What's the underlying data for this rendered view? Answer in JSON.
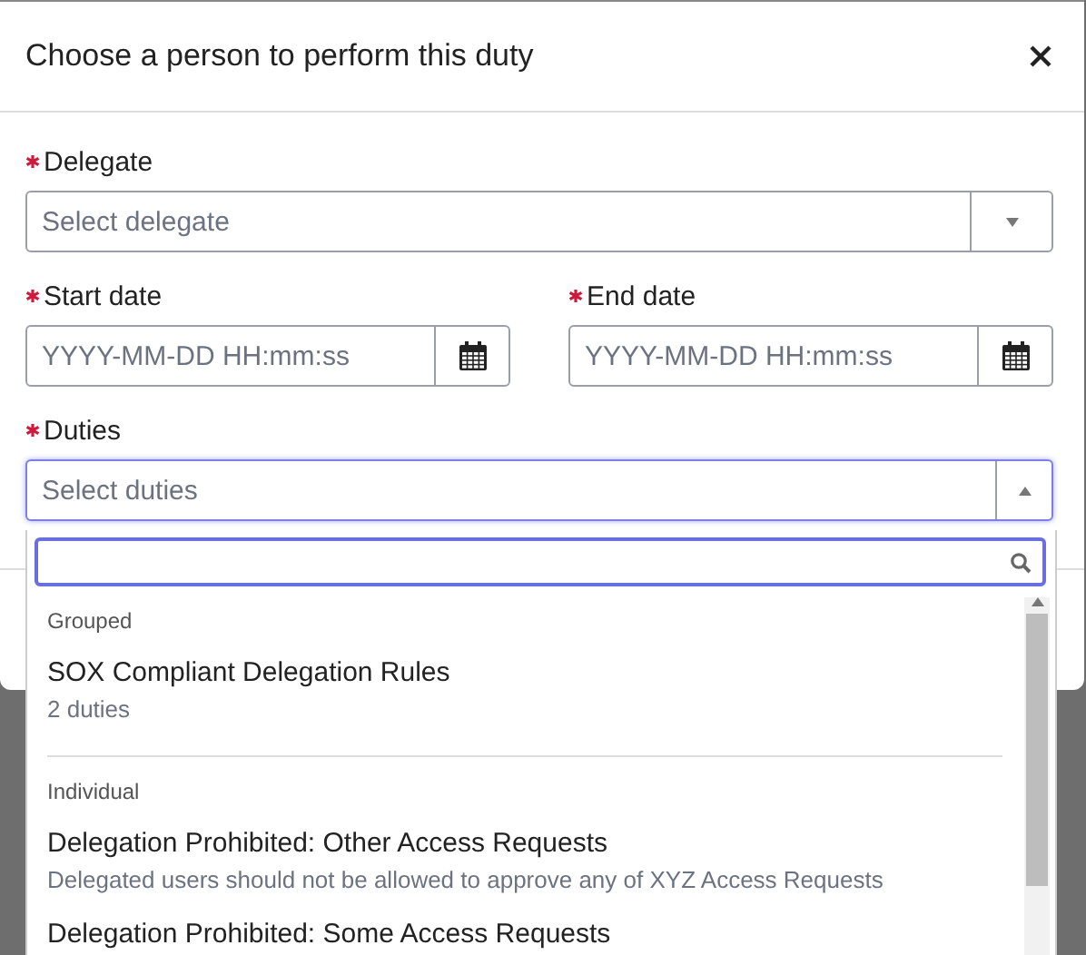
{
  "dialog": {
    "title": "Choose a person to perform this duty"
  },
  "delegate": {
    "label": "Delegate",
    "required": true,
    "placeholder": "Select delegate",
    "expanded": false
  },
  "date_fields": [
    {
      "label": "Start date",
      "required": true,
      "placeholder": "YYYY-MM-DD HH:mm:ss"
    },
    {
      "label": "End date",
      "required": true,
      "placeholder": "YYYY-MM-DD HH:mm:ss"
    }
  ],
  "duties": {
    "label": "Duties",
    "required": true,
    "placeholder": "Select duties",
    "expanded": true,
    "groups": [
      {
        "heading": "Grouped",
        "items": [
          {
            "title": "SOX Compliant Delegation Rules",
            "subtitle": "2 duties"
          }
        ]
      },
      {
        "heading": "Individual",
        "items": [
          {
            "title": "Delegation Prohibited: Other Access Requests",
            "subtitle": "Delegated users should not be allowed to approve any of XYZ Access Requests"
          },
          {
            "title": "Delegation Prohibited: Some Access Requests"
          }
        ]
      }
    ]
  }
}
